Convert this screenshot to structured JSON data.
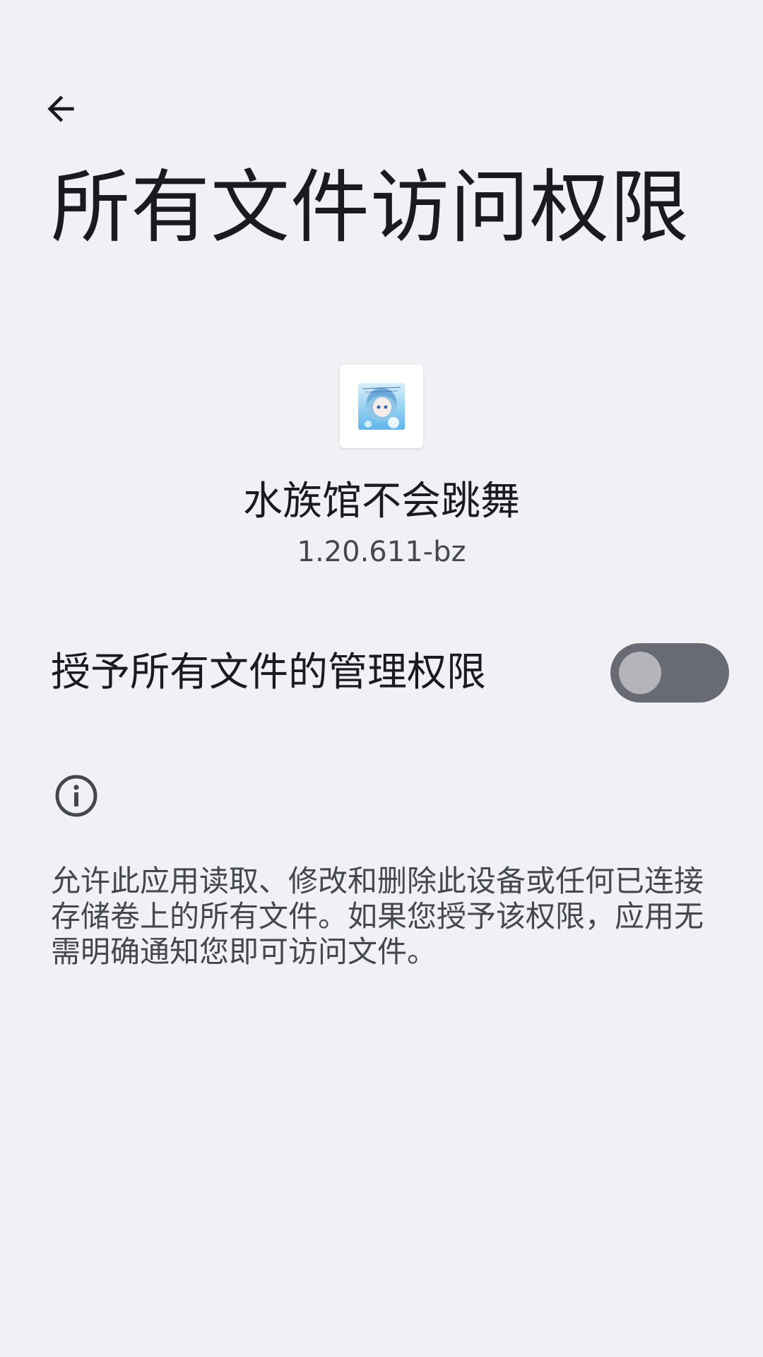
{
  "header": {
    "back_icon": "arrow-back-icon",
    "title": "所有文件访问权限"
  },
  "app": {
    "icon": "app-icon",
    "name": "水族馆不会跳舞",
    "version": "1.20.611-bz"
  },
  "permission": {
    "label": "授予所有文件的管理权限",
    "enabled": false
  },
  "info": {
    "icon": "info-icon",
    "description": "允许此应用读取、修改和删除此设备或任何已连接存储卷上的所有文件。如果您授予该权限，应用无需明确通知您即可访问文件。"
  },
  "colors": {
    "background": "#f0f0f5",
    "switch_track_off": "#686b74",
    "switch_thumb_off": "#b4b5ba",
    "text_primary": "#1b1b1f",
    "text_secondary": "#46464f"
  }
}
